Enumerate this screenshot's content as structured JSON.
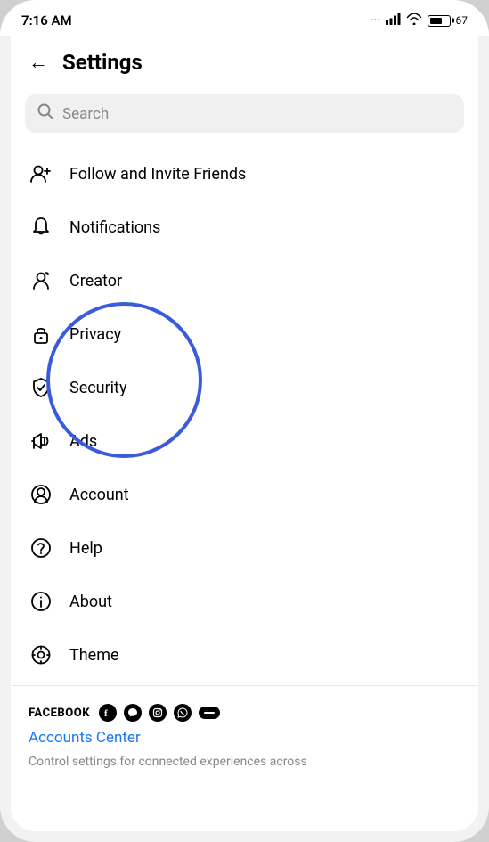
{
  "statusBar": {
    "time": "7:16 AM",
    "batteryLevel": 67
  },
  "header": {
    "backLabel": "←",
    "title": "Settings"
  },
  "search": {
    "placeholder": "Search"
  },
  "menuItems": [
    {
      "id": "follow",
      "label": "Follow and Invite Friends",
      "icon": "follow-icon"
    },
    {
      "id": "notifications",
      "label": "Notifications",
      "icon": "bell-icon"
    },
    {
      "id": "creator",
      "label": "Creator",
      "icon": "creator-icon"
    },
    {
      "id": "privacy",
      "label": "Privacy",
      "icon": "lock-icon"
    },
    {
      "id": "security",
      "label": "Security",
      "icon": "shield-icon"
    },
    {
      "id": "ads",
      "label": "Ads",
      "icon": "ads-icon"
    },
    {
      "id": "account",
      "label": "Account",
      "icon": "account-icon"
    },
    {
      "id": "help",
      "label": "Help",
      "icon": "help-icon"
    },
    {
      "id": "about",
      "label": "About",
      "icon": "about-icon"
    },
    {
      "id": "theme",
      "label": "Theme",
      "icon": "theme-icon"
    }
  ],
  "facebookSection": {
    "brandLabel": "FACEBOOK",
    "accountsCenterLabel": "Accounts Center",
    "accountsCenterDesc": "Control settings for connected experiences across"
  }
}
